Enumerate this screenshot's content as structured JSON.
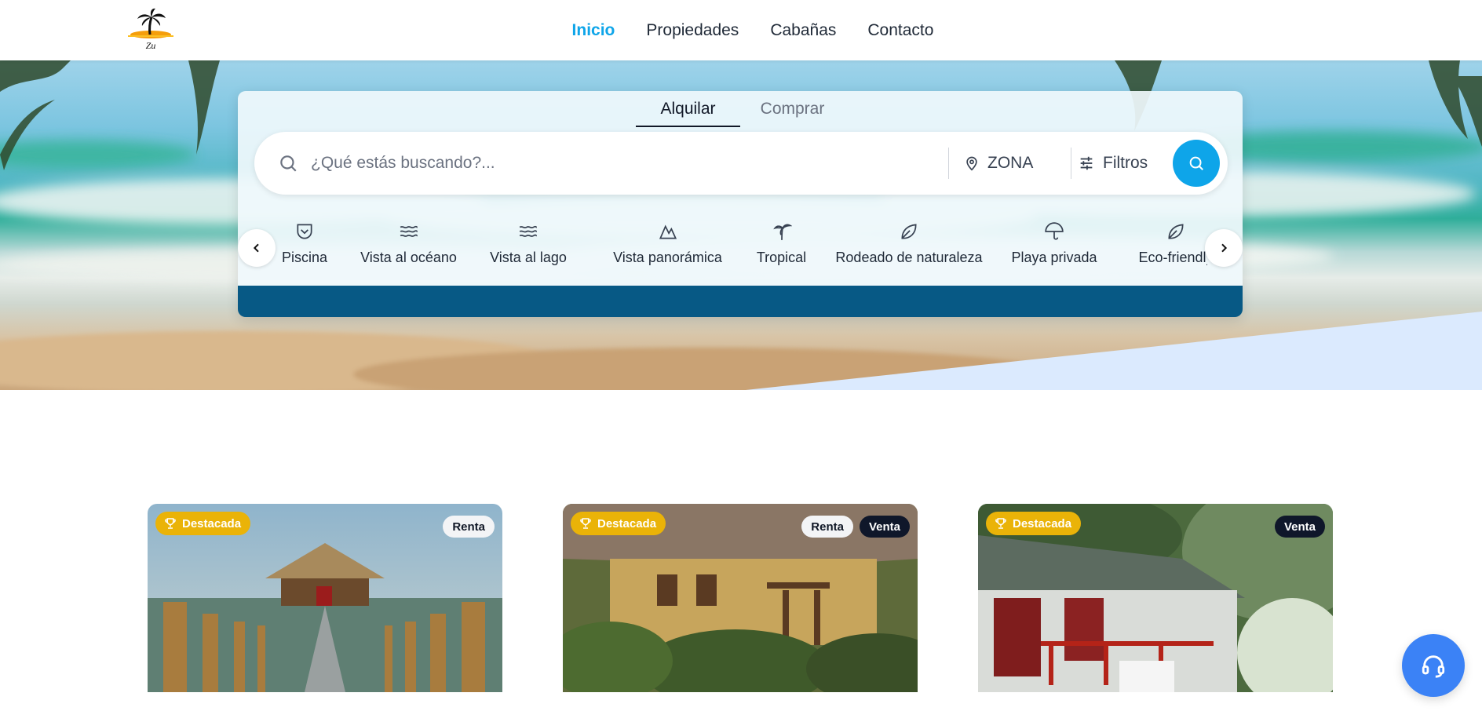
{
  "brand": {
    "logo_text": "Zu"
  },
  "nav": {
    "items": [
      {
        "label": "Inicio",
        "active": true
      },
      {
        "label": "Propiedades",
        "active": false
      },
      {
        "label": "Cabañas",
        "active": false
      },
      {
        "label": "Contacto",
        "active": false
      }
    ]
  },
  "search": {
    "tabs": [
      {
        "label": "Alquilar",
        "active": true
      },
      {
        "label": "Comprar",
        "active": false
      }
    ],
    "placeholder": "¿Qué estás buscando?...",
    "value": "",
    "zone_label": "ZONA",
    "filters_label": "Filtros"
  },
  "categories": [
    {
      "label": "Piscina",
      "icon": "pool-icon"
    },
    {
      "label": "Vista al océano",
      "icon": "waves-icon"
    },
    {
      "label": "Vista al lago",
      "icon": "waves-icon"
    },
    {
      "label": "Vista panorámica",
      "icon": "mountain-icon"
    },
    {
      "label": "Tropical",
      "icon": "palm-tree-icon"
    },
    {
      "label": "Rodeado de naturaleza",
      "icon": "leaf-icon"
    },
    {
      "label": "Playa privada",
      "icon": "umbrella-icon"
    },
    {
      "label": "Eco-friendly",
      "icon": "leaf-icon"
    }
  ],
  "cards": [
    {
      "featured_label": "Destacada",
      "tags": [
        "Renta"
      ]
    },
    {
      "featured_label": "Destacada",
      "tags": [
        "Renta",
        "Venta"
      ]
    },
    {
      "featured_label": "Destacada",
      "tags": [
        "Venta"
      ]
    }
  ],
  "colors": {
    "accent": "#0ea5e9",
    "panel_band": "#075985",
    "featured": "#eab308",
    "help_button": "#3b82f6"
  }
}
